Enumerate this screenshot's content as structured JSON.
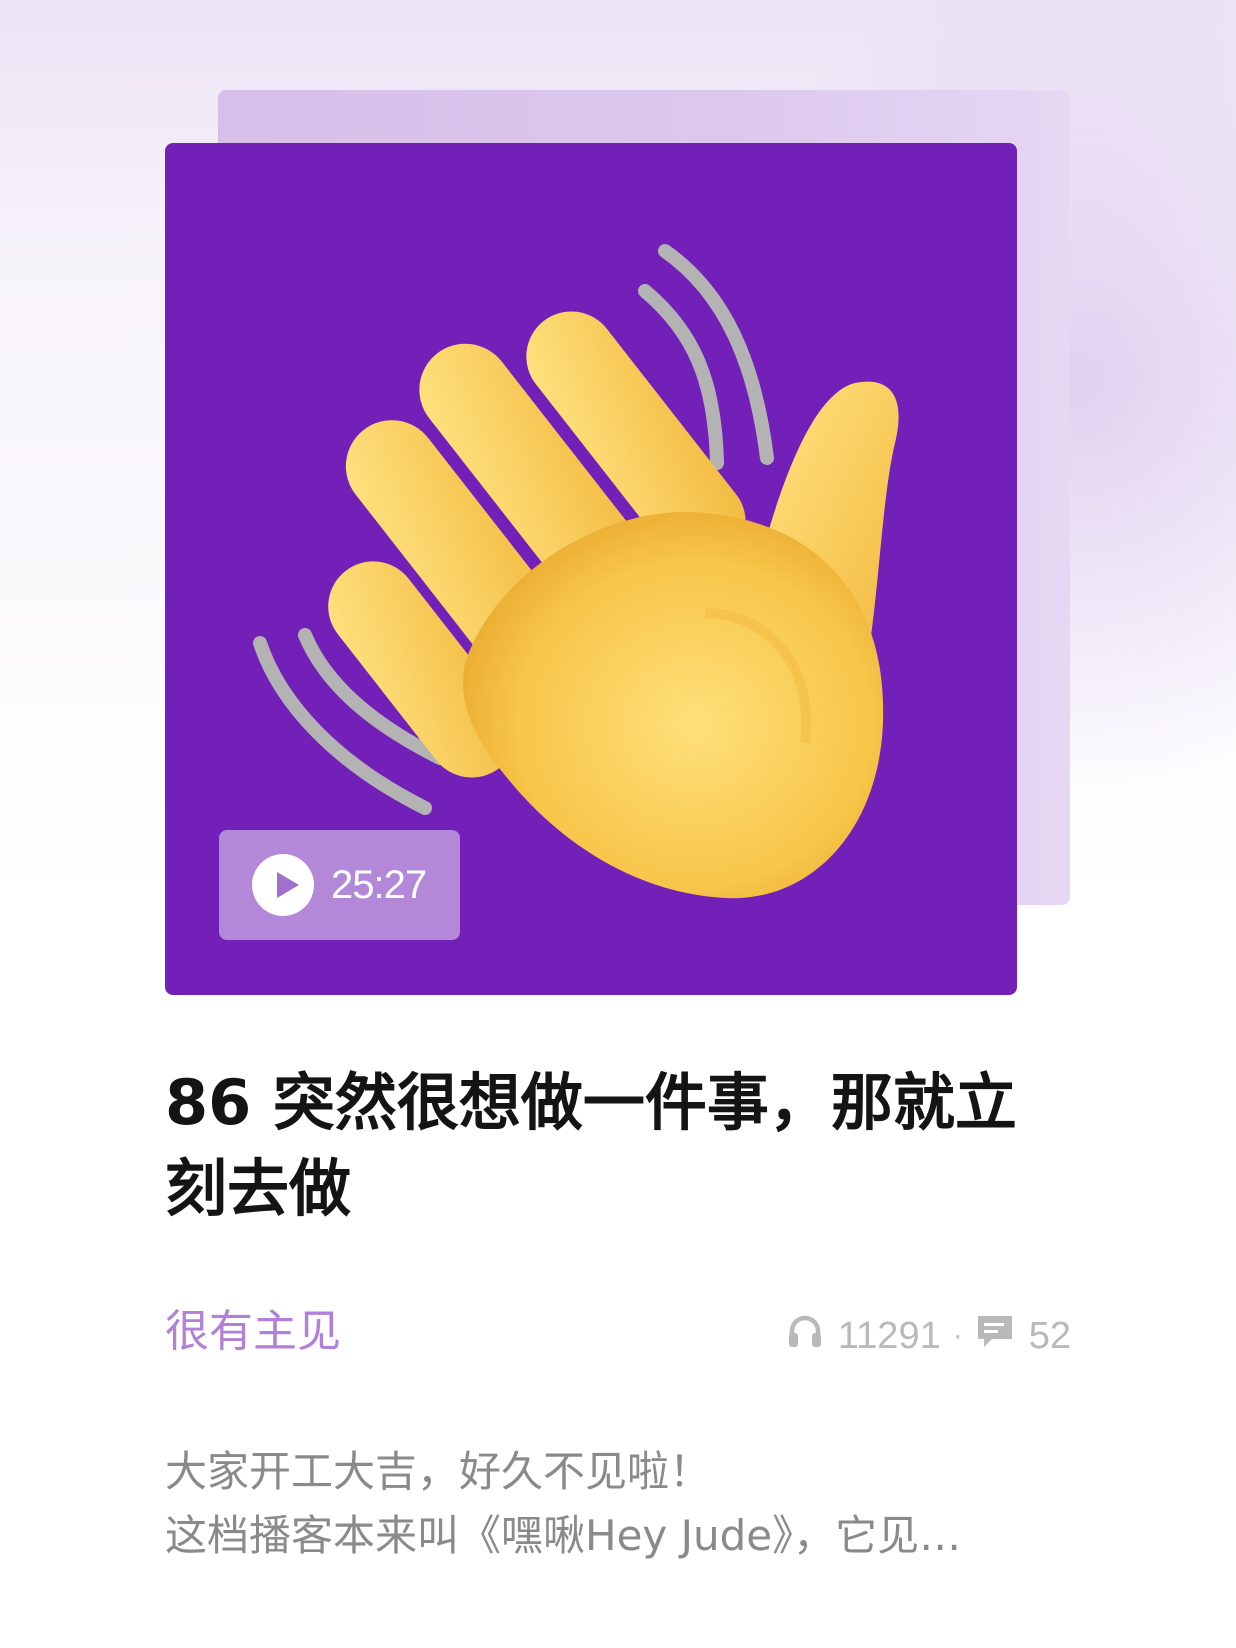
{
  "episode": {
    "duration": "25:27",
    "title": "86 突然很想做一件事，那就立刻去做",
    "channel": "很有主见",
    "plays": "11291",
    "comments": "52",
    "description_lines": [
      "大家开工大吉，好久不见啦！",
      "这档播客本来叫《嘿啾Hey Jude》，它见…"
    ]
  },
  "icons": {
    "cover_art": "waving-hand-emoji",
    "play": "play-icon",
    "plays": "headphones-icon",
    "comments": "comment-icon"
  },
  "colors": {
    "cover_background": "#7220b8",
    "accent": "#b280d6",
    "title": "#141414",
    "muted": "#8a8a8a"
  }
}
